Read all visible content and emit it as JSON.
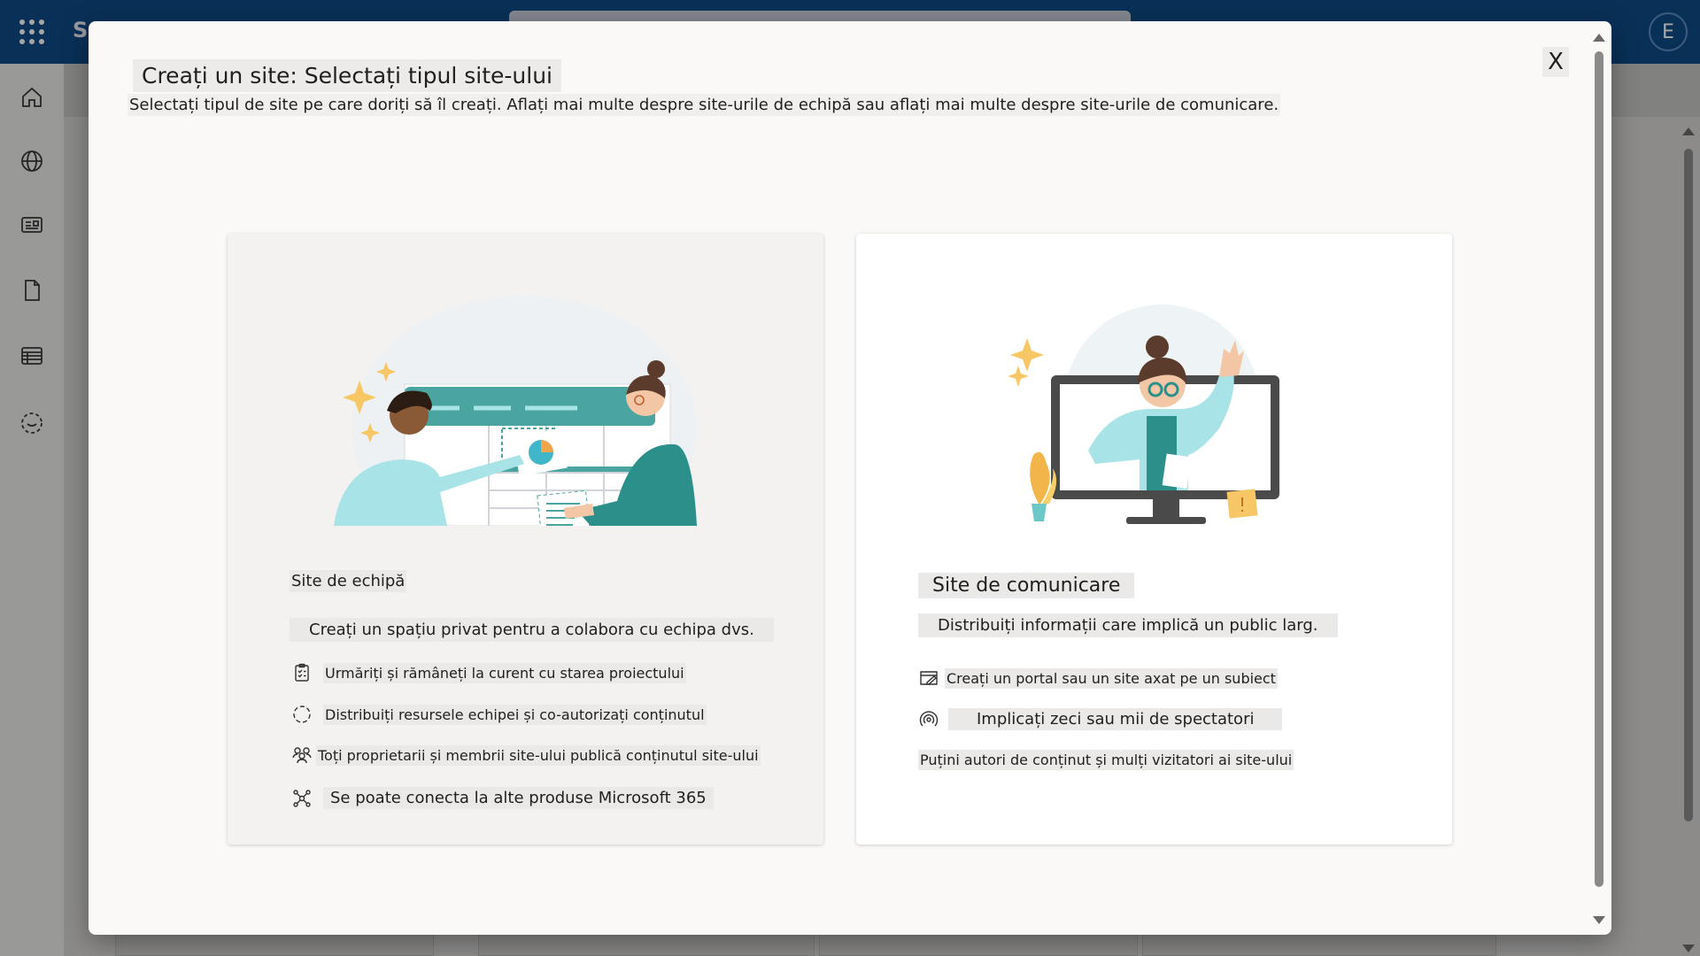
{
  "app": {
    "name_partial": "S",
    "avatar_initial": "E"
  },
  "rail_icons": [
    "home-icon",
    "globe-icon",
    "news-icon",
    "file-icon",
    "list-icon",
    "create-icon"
  ],
  "dialog": {
    "title": "Creați un site: Selectați tipul site-ului",
    "subtitle": "Selectați tipul de site pe care doriți să îl creați. Aflați mai multe despre site-urile de echipă sau aflați mai multe despre site-urile de comunicare.",
    "close_label": "X"
  },
  "team_site": {
    "title": "Site de echipă",
    "description": "Creați un spațiu privat pentru a colabora cu echipa dvs.",
    "features": [
      {
        "icon": "clipboard-icon",
        "text": "Urmăriți și rămâneți la curent cu starea proiectului"
      },
      {
        "icon": "sync-icon",
        "text": "Distribuiți resursele echipei și co-autorizați conținutul"
      },
      {
        "icon": "people-icon",
        "text": "Toți proprietarii și membrii site-ului publică conținutul site-ului"
      },
      {
        "icon": "connect-icon",
        "text": "Se poate conecta la alte produse Microsoft 365"
      }
    ]
  },
  "communication_site": {
    "title": "Site de comunicare",
    "description": "Distribuiți informații care implică un public larg.",
    "features": [
      {
        "icon": "edit-page-icon",
        "text": "Creați un portal sau un site axat pe un subiect"
      },
      {
        "icon": "broadcast-icon",
        "text": "Implicați zeci sau mii de spectatori"
      },
      {
        "icon": "",
        "text": "Puțini autori de conținut și mulți vizitatori ai site-ului"
      }
    ]
  },
  "colors": {
    "top_bar": "#0f4a86",
    "teal": "#4aa5a0",
    "light_teal": "#a8e3e8",
    "star": "#f7c765"
  }
}
